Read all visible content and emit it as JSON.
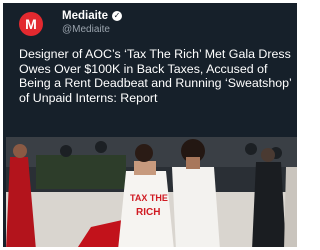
{
  "post": {
    "account_name": "Mediaite",
    "handle": "@Mediaite",
    "avatar_letter": "M",
    "verified_icon": "verified-badge-icon",
    "headline": "Designer of AOC’s ‘Tax The Rich’ Met Gala Dress Owes Over $100K in Back Taxes, Accused of Being a Rent Deadbeat and Running ‘Sweatshop’ of Unpaid Interns: Report",
    "dress_text_1": "TAX THE",
    "dress_text_2": "RICH"
  },
  "colors": {
    "background": "#16202a",
    "avatar": "#e3292f",
    "text": "#ffffff",
    "handle": "#9aa3ad"
  }
}
